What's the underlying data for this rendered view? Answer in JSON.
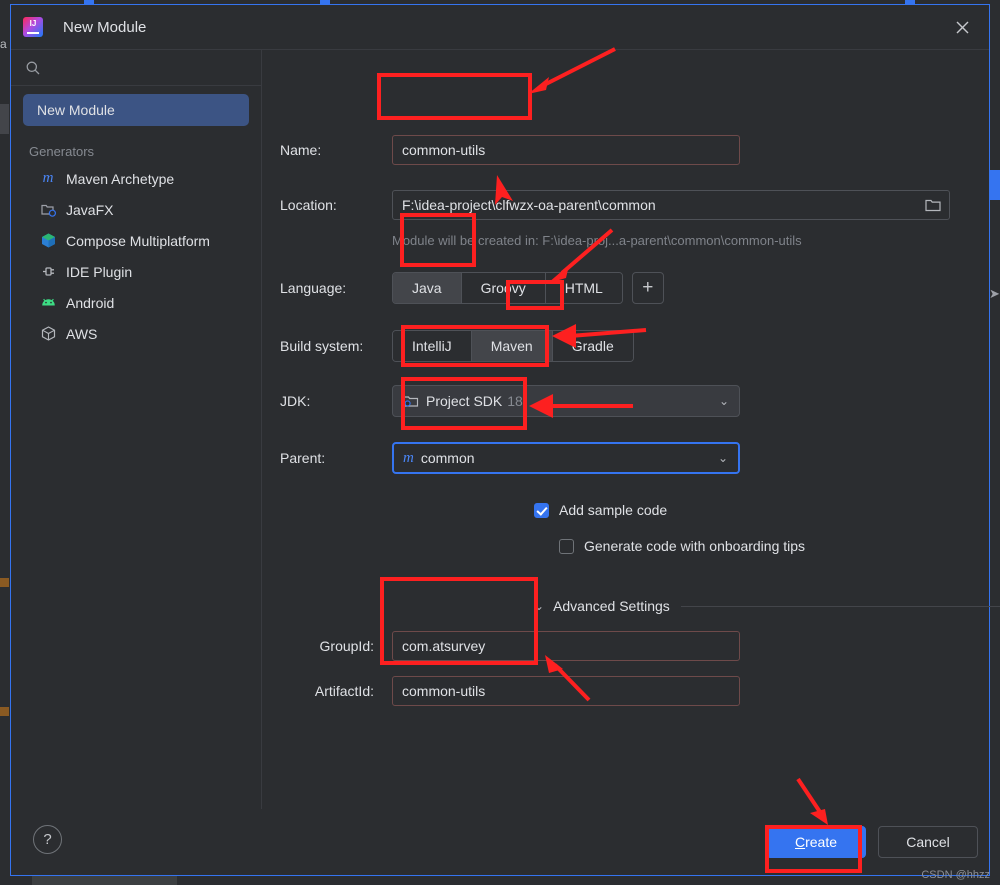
{
  "window": {
    "title": "New Module",
    "logo_icon": "intellij-idea-logo",
    "close_icon": "close-icon"
  },
  "sidebar": {
    "search": {
      "placeholder": "",
      "value": "",
      "icon": "search-icon"
    },
    "selected_item": {
      "label": "New Module"
    },
    "section_label": "Generators",
    "generators": [
      {
        "label": "Maven Archetype",
        "icon": "maven-icon",
        "glyph": "m"
      },
      {
        "label": "JavaFX",
        "icon": "javafx-icon",
        "glyph": ""
      },
      {
        "label": "Compose Multiplatform",
        "icon": "compose-multiplatform-icon",
        "glyph": ""
      },
      {
        "label": "IDE Plugin",
        "icon": "ide-plugin-icon",
        "glyph": ""
      },
      {
        "label": "Android",
        "icon": "android-icon",
        "glyph": ""
      },
      {
        "label": "AWS",
        "icon": "aws-icon",
        "glyph": ""
      }
    ]
  },
  "form": {
    "name": {
      "label": "Name:",
      "value": "common-utils"
    },
    "location": {
      "label": "Location:",
      "value": "F:\\idea-project\\clfwzx-oa-parent\\common",
      "browse_icon": "folder-browse-icon"
    },
    "location_hint": "Module will be created in: F:\\idea-proj...a-parent\\common\\common-utils",
    "language": {
      "label": "Language:",
      "options": [
        "Java",
        "Groovy",
        "HTML"
      ],
      "selected": "Java",
      "add_label": "+"
    },
    "build_system": {
      "label": "Build system:",
      "options": [
        "IntelliJ",
        "Maven",
        "Gradle"
      ],
      "selected": "Maven"
    },
    "jdk": {
      "label": "JDK:",
      "value": "Project SDK",
      "version": "18",
      "icon": "folder-sdk-icon"
    },
    "parent": {
      "label": "Parent:",
      "value": "common",
      "icon": "maven-icon",
      "glyph": "m"
    },
    "add_sample_code": {
      "label": "Add sample code",
      "checked": true
    },
    "onboarding_tips": {
      "label": "Generate code with onboarding tips",
      "checked": false
    },
    "advanced_settings": {
      "label": "Advanced Settings",
      "expanded": true,
      "chevron_icon": "chevron-down-icon",
      "group_id": {
        "label": "GroupId:",
        "value": "com.atsurvey"
      },
      "artifact_id": {
        "label": "ArtifactId:",
        "value": "common-utils"
      }
    }
  },
  "footer": {
    "help_label": "?",
    "create": {
      "label": "Create",
      "mnemonic": "C",
      "rest": "reate"
    },
    "cancel": {
      "label": "Cancel"
    }
  },
  "overlay": {
    "watermark": "CSDN @hhzz",
    "annotation_color": "#fd2020"
  },
  "background": {
    "left_letter": "a",
    "right_arrow": "➤"
  }
}
